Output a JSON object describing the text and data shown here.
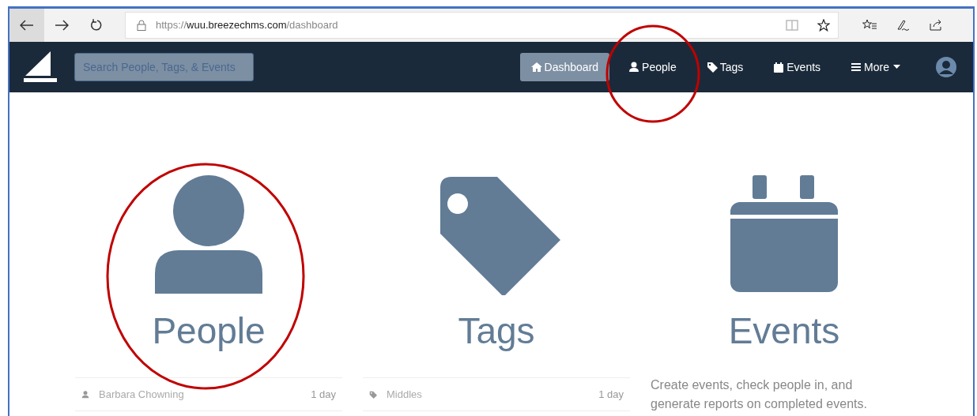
{
  "browser": {
    "url": {
      "scheme": "https://",
      "host": "wuu.breezechms.com",
      "path": "/dashboard"
    }
  },
  "navbar": {
    "search": {
      "placeholder": "Search People, Tags, & Events"
    },
    "items": [
      {
        "label": "Dashboard",
        "kind": "home",
        "selected": true
      },
      {
        "label": "People",
        "kind": "person",
        "selected": false
      },
      {
        "label": "Tags",
        "kind": "tag",
        "selected": false
      },
      {
        "label": "Events",
        "kind": "calendar",
        "selected": false
      },
      {
        "label": "More",
        "kind": "menu",
        "selected": false
      }
    ]
  },
  "cards": [
    {
      "kind": "person",
      "title": "People",
      "recent": [
        {
          "name": "Barbara Chowning",
          "age": "1 day"
        }
      ]
    },
    {
      "kind": "tag",
      "title": "Tags",
      "recent": [
        {
          "name": "Middles",
          "age": "1 day"
        }
      ]
    },
    {
      "kind": "calendar",
      "title": "Events",
      "description": "Create events, check people in, and generate reports on completed events."
    }
  ]
}
